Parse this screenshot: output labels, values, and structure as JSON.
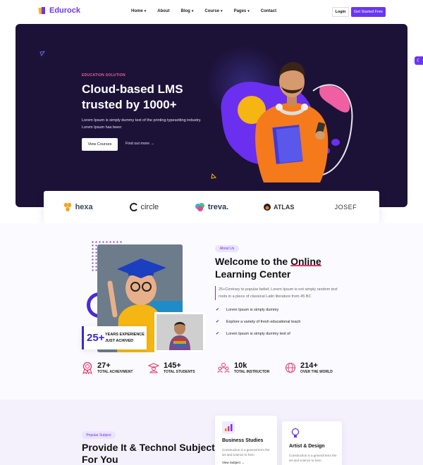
{
  "nav": {
    "logo": "Edurock",
    "menu": [
      {
        "label": "Home",
        "dropdown": true
      },
      {
        "label": "About",
        "dropdown": false
      },
      {
        "label": "Blog",
        "dropdown": true
      },
      {
        "label": "Course",
        "dropdown": true
      },
      {
        "label": "Pages",
        "dropdown": true
      },
      {
        "label": "Contact",
        "dropdown": false
      }
    ],
    "login": "Login",
    "get_started": "Get Started Free"
  },
  "hero": {
    "eyebrow": "EDUCATION SOLUTION",
    "title": "Cloud-based LMS trusted by 1000+",
    "description": "Lorem Ipsum is simply dummy text of the printing typesetting industry. Lorem Ipsum has been",
    "primary_button": "View Courses",
    "secondary_link": "Find out more →"
  },
  "brands": [
    "hexa",
    "circle",
    "treva.",
    "ATLAS",
    "JOSEF"
  ],
  "welcome": {
    "pill": "About Us",
    "title_start": "Welcome to the",
    "title_highlight": "Online",
    "title_end": "Learning Center",
    "description": "25+Contrary to popular belief, Lorem Ipsum is not simply random text roots in a piece of classical Latin literature from 45 BC",
    "checklist": [
      "Lorem Ipsum is simply dummy",
      "Explore a variety of fresh educational teach",
      "Lorem Ipsum is simply dummy text of"
    ],
    "years_number": "25+",
    "years_label_1": "YEARS EXPERIENCE",
    "years_label_2": "JUST ACHIVED"
  },
  "stats": [
    {
      "value": "27+",
      "label": "TOTAL ACHEIVMENT",
      "icon": "award-icon"
    },
    {
      "value": "145+",
      "label": "TOTAL STUDENTS",
      "icon": "graduate-icon"
    },
    {
      "value": "10k",
      "label": "TOTAL INSTRUCTOR",
      "icon": "instructor-icon"
    },
    {
      "value": "214+",
      "label": "OVER THE WORLD",
      "icon": "globe-icon"
    }
  ],
  "popular": {
    "pill": "Popular Subject",
    "title": "Provide It & Technol Subject For You",
    "cards": [
      {
        "title": "Business Studies",
        "description": "Construction is a general term the art and science to form",
        "link": "View Subject →",
        "icon": "chart-icon"
      },
      {
        "title": "Artist & Design",
        "description": "Construction is a general term the art and science to form",
        "icon": "lightbulb-icon"
      }
    ]
  },
  "colors": {
    "brand": "#6a36f0",
    "hero_bg": "#1c1238",
    "accent_pink": "#ef5fa2",
    "accent_orange": "#f57a1c",
    "accent_yellow": "#f5b512",
    "link_blue": "#3a2ad0"
  }
}
